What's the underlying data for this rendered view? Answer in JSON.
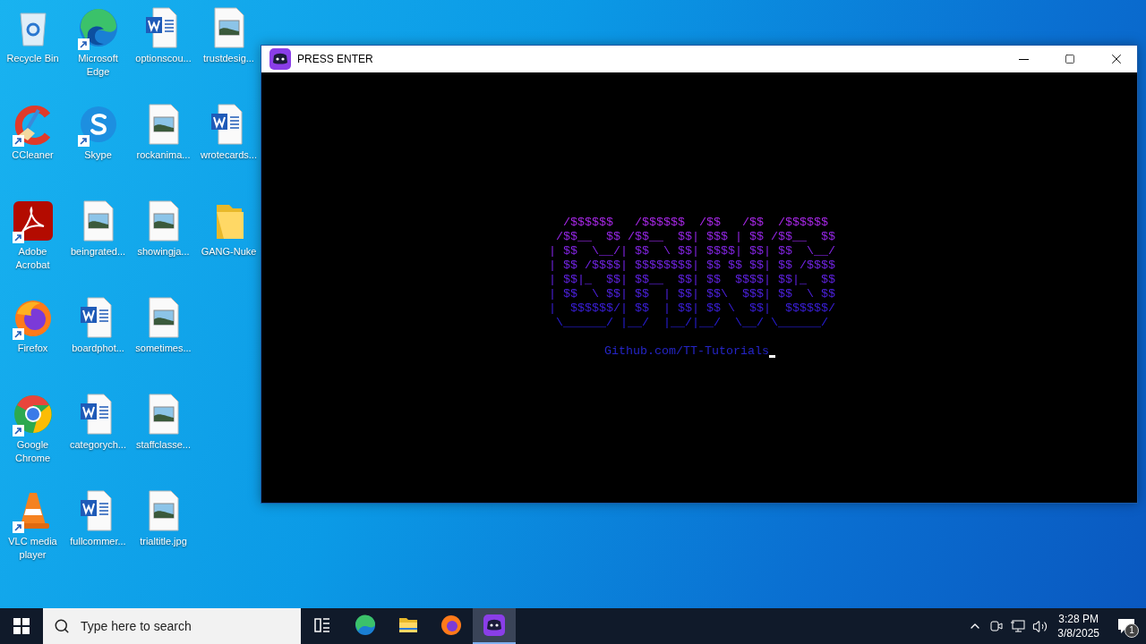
{
  "desktop": {
    "icons": [
      {
        "label": "Recycle Bin",
        "kind": "recycle",
        "shortcut": false
      },
      {
        "label": "CCleaner",
        "kind": "ccleaner",
        "shortcut": true
      },
      {
        "label": "Adobe Acrobat",
        "kind": "acrobat",
        "shortcut": true
      },
      {
        "label": "Firefox",
        "kind": "firefox",
        "shortcut": true
      },
      {
        "label": "Google Chrome",
        "kind": "chrome",
        "shortcut": true
      },
      {
        "label": "VLC media player",
        "kind": "vlc",
        "shortcut": true
      },
      {
        "label": "Microsoft Edge",
        "kind": "edge",
        "shortcut": true
      },
      {
        "label": "Skype",
        "kind": "skype",
        "shortcut": true
      },
      {
        "label": "beingrated...",
        "kind": "image",
        "shortcut": false
      },
      {
        "label": "boardphot...",
        "kind": "word",
        "shortcut": false
      },
      {
        "label": "categorych...",
        "kind": "word",
        "shortcut": false
      },
      {
        "label": "fullcommer...",
        "kind": "word",
        "shortcut": false
      },
      {
        "label": "optionscou...",
        "kind": "word",
        "shortcut": false
      },
      {
        "label": "rockanima...",
        "kind": "image",
        "shortcut": false
      },
      {
        "label": "showingja...",
        "kind": "image",
        "shortcut": false
      },
      {
        "label": "sometimes...",
        "kind": "image",
        "shortcut": false
      },
      {
        "label": "staffclasse...",
        "kind": "image",
        "shortcut": false
      },
      {
        "label": "trialtitle.jpg",
        "kind": "image",
        "shortcut": false
      },
      {
        "label": "trustdesig...",
        "kind": "image",
        "shortcut": false
      },
      {
        "label": "wrotecards...",
        "kind": "word",
        "shortcut": false
      },
      {
        "label": "GANG-Nuke",
        "kind": "folder",
        "shortcut": false
      }
    ]
  },
  "window": {
    "title": "PRESS ENTER",
    "console": {
      "art_lines": [
        "  /$$$$$$   /$$$$$$  /$$   /$$  /$$$$$$ ",
        " /$$__  $$ /$$__  $$| $$$ | $$ /$$__  $$",
        "| $$  \\__/| $$  \\ $$| $$$$| $$| $$  \\__/",
        "| $$ /$$$$| $$$$$$$$| $$ $$ $$| $$ /$$$$",
        "| $$|_  $$| $$__  $$| $$  $$$$| $$|_  $$",
        "| $$  \\ $$| $$  | $$| $$\\  $$$| $$  \\ $$",
        "|  $$$$$$/| $$  | $$| $$ \\  $$|  $$$$$$/",
        " \\______/ |__/  |__/|__/  \\__/ \\______/ "
      ],
      "link": "Github.com/TT-Tutorials",
      "cursor": true
    }
  },
  "taskbar": {
    "search": {
      "placeholder": "Type here to search"
    },
    "apps": [
      {
        "kind": "taskview",
        "active": false
      },
      {
        "kind": "edge",
        "active": false
      },
      {
        "kind": "explorer",
        "active": false
      },
      {
        "kind": "firefox",
        "active": false
      },
      {
        "kind": "discord",
        "active": true
      }
    ],
    "tray": {
      "time": "3:28 PM",
      "date": "3/8/2025",
      "notifications": "1"
    }
  }
}
